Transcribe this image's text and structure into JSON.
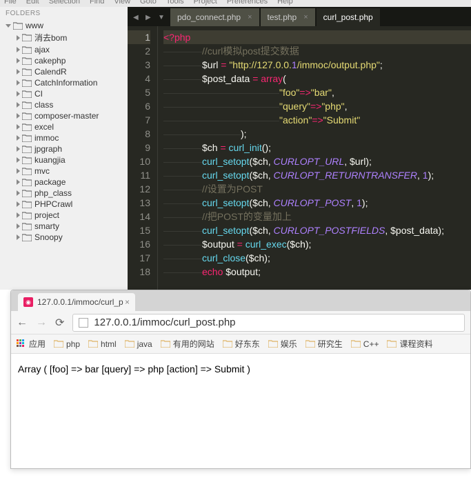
{
  "menubar": [
    "File",
    "Edit",
    "Selection",
    "Find",
    "View",
    "Goto",
    "Tools",
    "Project",
    "Preferences",
    "Help"
  ],
  "sidebar": {
    "header": "FOLDERS",
    "root": "www",
    "items": [
      "消去bom",
      "ajax",
      "cakephp",
      "CalendR",
      "CatchInformation",
      "CI",
      "class",
      "composer-master",
      "excel",
      "immoc",
      "jpgraph",
      "kuangjia",
      "mvc",
      "package",
      "php_class",
      "PHPCrawl",
      "project",
      "smarty",
      "Snoopy"
    ]
  },
  "tabs": {
    "items": [
      {
        "label": "pdo_connect.php",
        "active": false,
        "closeable": true
      },
      {
        "label": "test.php",
        "active": false,
        "closeable": true
      },
      {
        "label": "curl_post.php",
        "active": true,
        "closeable": false
      }
    ]
  },
  "code": {
    "lines": [
      {
        "n": 1,
        "t": "<?php"
      },
      {
        "n": 2,
        "t": "    //curl模拟post提交数据"
      },
      {
        "n": 3,
        "t": "    $url = \"http://127.0.0.1/immoc/output.php\";"
      },
      {
        "n": 4,
        "t": "    $post_data = array("
      },
      {
        "n": 5,
        "t": "            \"foo\"=>\"bar\","
      },
      {
        "n": 6,
        "t": "            \"query\"=>\"php\","
      },
      {
        "n": 7,
        "t": "            \"action\"=>\"Submit\""
      },
      {
        "n": 8,
        "t": "        );"
      },
      {
        "n": 9,
        "t": "    $ch = curl_init();"
      },
      {
        "n": 10,
        "t": "    curl_setopt($ch, CURLOPT_URL, $url);"
      },
      {
        "n": 11,
        "t": "    curl_setopt($ch, CURLOPT_RETURNTRANSFER, 1);"
      },
      {
        "n": 12,
        "t": "    //设置为POST"
      },
      {
        "n": 13,
        "t": "    curl_setopt($ch, CURLOPT_POST, 1);"
      },
      {
        "n": 14,
        "t": "    //把POST的变量加上"
      },
      {
        "n": 15,
        "t": "    curl_setopt($ch, CURLOPT_POSTFIELDS, $post_data);"
      },
      {
        "n": 16,
        "t": "    $output = curl_exec($ch);"
      },
      {
        "n": 17,
        "t": "    curl_close($ch);"
      },
      {
        "n": 18,
        "t": "    echo $output;"
      }
    ]
  },
  "browser": {
    "tab_title": "127.0.0.1/immoc/curl_p",
    "url": "127.0.0.1/immoc/curl_post.php",
    "bookmarks_label_apps": "应用",
    "bookmarks": [
      "php",
      "html",
      "java",
      "有用的网站",
      "好东东",
      "娱乐",
      "研究生",
      "C++",
      "课程资料"
    ],
    "output": "Array ( [foo] => bar [query] => php [action] => Submit )"
  }
}
